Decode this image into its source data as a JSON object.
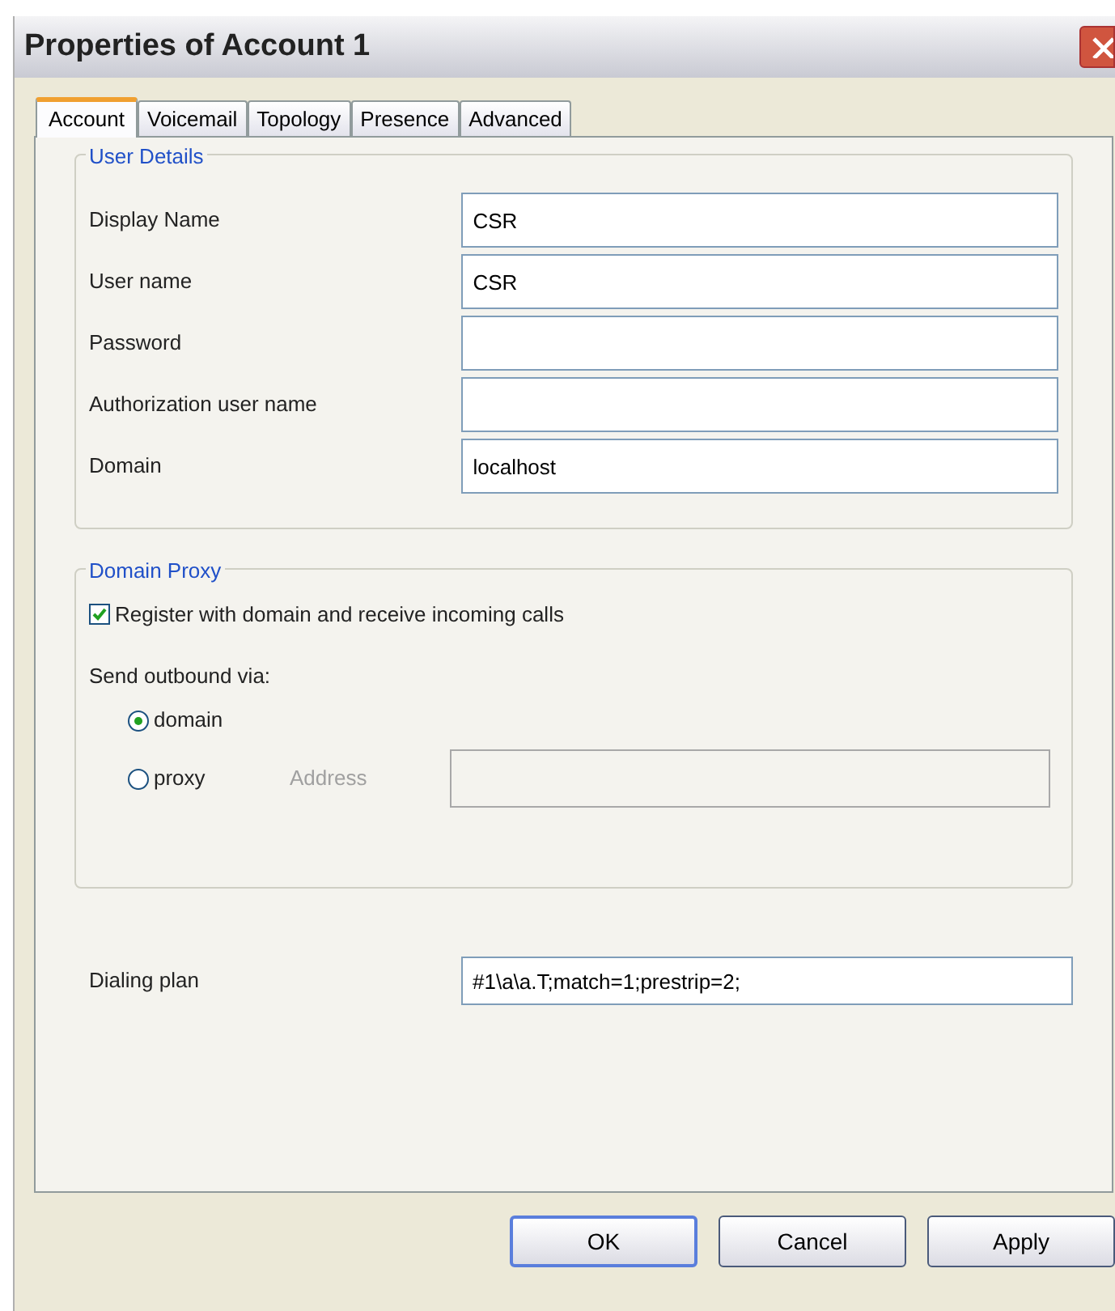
{
  "window": {
    "title": "Properties of Account 1"
  },
  "tabs": [
    {
      "label": "Account",
      "selected": true
    },
    {
      "label": "Voicemail",
      "selected": false
    },
    {
      "label": "Topology",
      "selected": false
    },
    {
      "label": "Presence",
      "selected": false
    },
    {
      "label": "Advanced",
      "selected": false
    }
  ],
  "user_details": {
    "title": "User Details",
    "fields": [
      {
        "label": "Display Name",
        "value": "CSR"
      },
      {
        "label": "User name",
        "value": "CSR"
      },
      {
        "label": "Password"
      },
      {
        "label": "Authorization user name"
      },
      {
        "label": "Domain",
        "value": "localhost"
      }
    ]
  },
  "domain_proxy": {
    "title": "Domain Proxy",
    "register": {
      "label": "Register with domain and receive incoming calls",
      "checked": true
    },
    "send_label": "Send outbound via:",
    "options": [
      {
        "label": "domain",
        "selected": true
      },
      {
        "label": "proxy",
        "selected": false
      }
    ],
    "address": {
      "label": "Address",
      "disabled": true
    }
  },
  "dialing_plan": {
    "label": "Dialing plan",
    "value": "#1\\a\\a.T;match=1;prestrip=2;"
  },
  "buttons": [
    {
      "label": "OK",
      "default": true
    },
    {
      "label": "Cancel",
      "default": false
    },
    {
      "label": "Apply",
      "default": false
    }
  ]
}
